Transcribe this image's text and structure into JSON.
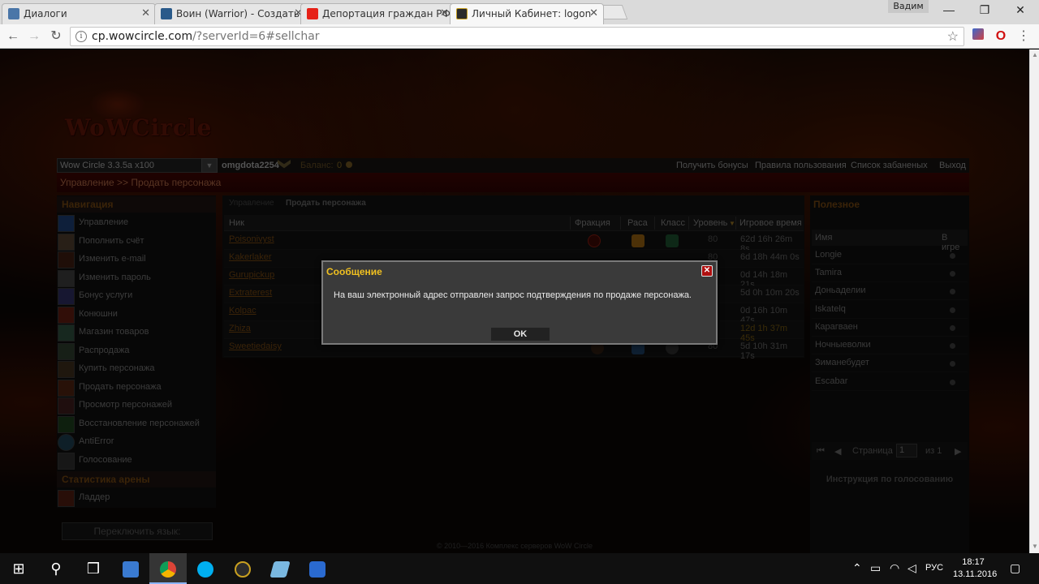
{
  "browser": {
    "tabs": [
      {
        "title": "Диалоги",
        "color": "#4a76a8"
      },
      {
        "title": "Воин (Warrior) - Создать",
        "color": "#2a5a8a"
      },
      {
        "title": "Депортация граждан РФ",
        "color": "#e62117"
      },
      {
        "title": "Личный Кабинет: logon",
        "color": "#2b2b2b"
      }
    ],
    "user_name": "Вадим",
    "url_host": "cp.wowcircle.com",
    "url_rest": "/?serverId=6#sellchar"
  },
  "site": {
    "logo": "WoWCircle",
    "server": "Wow Circle 3.3.5a x100",
    "username": "omgdota2254",
    "balance_label": "Баланс:",
    "balance_value": "0",
    "top_links": [
      "Получить бонусы",
      "Правила пользования",
      "Список забаненых",
      "Выход"
    ],
    "breadcrumb": "Управление >> Продать персонажа",
    "nav_title": "Навигация",
    "nav_items": [
      "Управление",
      "Пополнить счёт",
      "Изменить e-mail",
      "Изменить пароль",
      "Бонус услуги",
      "Конюшни",
      "Магазин товаров",
      "Распродажа",
      "Купить персонажа",
      "Продать персонажа",
      "Просмотр персонажей",
      "Восстановление персонажей",
      "AntiError",
      "Голосование"
    ],
    "arena_title": "Статистика арены",
    "arena_items": [
      "Ладдер"
    ],
    "lang_button": "Переключить язык:",
    "content_tabs": [
      "Управление",
      "Продать персонажа"
    ],
    "table_headers": [
      "Ник",
      "Фракция",
      "Раса",
      "Класс",
      "Уровень",
      "Игровое время"
    ],
    "characters": [
      {
        "name": "Poisonivyst",
        "level": "80",
        "time": "62d 16h 26m 8s"
      },
      {
        "name": "Kakerlaker",
        "level": "80",
        "time": "6d 18h 44m 0s"
      },
      {
        "name": "Gurupickup",
        "level": "80",
        "time": "0d 14h 18m 21s"
      },
      {
        "name": "Extraterest",
        "level": "80",
        "time": "5d 0h 10m 20s"
      },
      {
        "name": "Kolpac",
        "level": "80",
        "time": "0d 16h 10m 47s"
      },
      {
        "name": "Zhiza",
        "level": "80",
        "time": "12d 1h 37m 45s"
      },
      {
        "name": "Sweetiedaisy",
        "level": "80",
        "time": "5d 10h 31m 17s"
      }
    ],
    "useful_title": "Полезное",
    "useful_headers": [
      "Имя",
      "В игре"
    ],
    "players": [
      "Longie",
      "Tamira",
      "Доньаделии",
      "Iskatelq",
      "Карагваен",
      "Ночныеволки",
      "Зиманебудет",
      "Escabar"
    ],
    "pager_page_label": "Страница",
    "pager_page": "1",
    "pager_of": "из 1",
    "vote_instructions": "Инструкция по голосованию",
    "footer": "© 2010—2016 Комплекс серверов WoW Circle"
  },
  "dialog": {
    "title": "Сообщение",
    "message": "На ваш электронный адрес отправлен запрос подтверждения по продаже персонажа.",
    "ok": "OK"
  },
  "taskbar": {
    "language": "РУС",
    "time": "18:17",
    "date": "13.11.2016"
  }
}
